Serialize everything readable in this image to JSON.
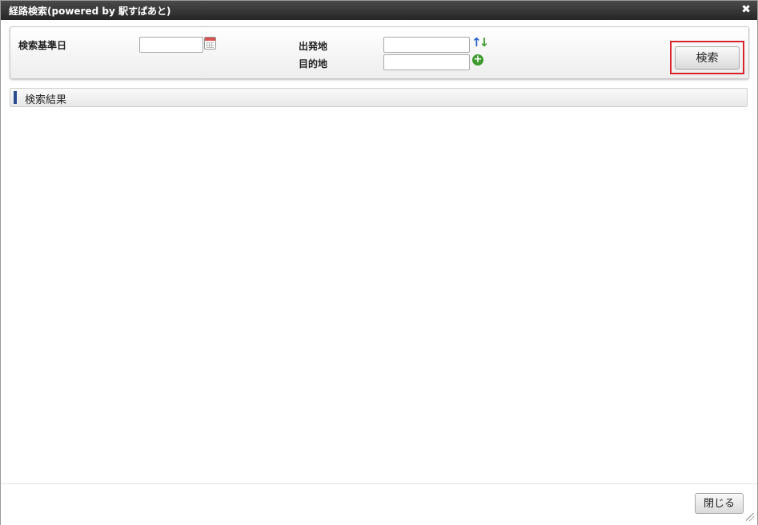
{
  "dialog": {
    "title": "経路検索(powered by 駅すぱあと)",
    "close_icon": "✖"
  },
  "search": {
    "base_date_label": "検索基準日",
    "base_date_value": "",
    "departure_label": "出発地",
    "departure_value": "",
    "destination_label": "目的地",
    "destination_value": "",
    "search_button": "検索",
    "icons": {
      "calendar": "calendar-icon",
      "swap": "swap-arrows-icon",
      "add": "add-circle-icon"
    },
    "highlight_color": "#d9232d"
  },
  "results": {
    "title": "検索結果"
  },
  "footer": {
    "close_button": "閉じる"
  }
}
